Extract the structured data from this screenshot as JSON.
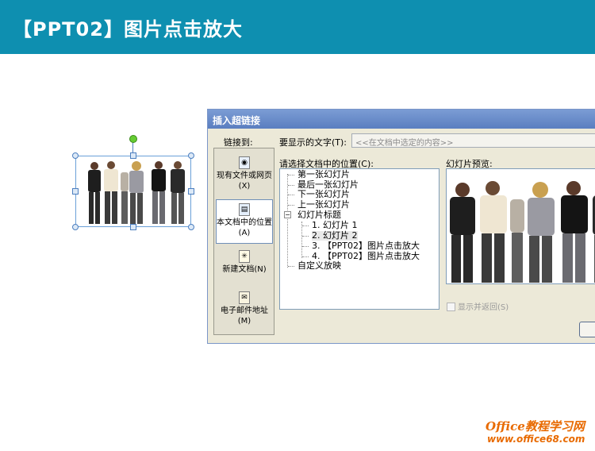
{
  "slide": {
    "title": "【PPT02】图片点击放大"
  },
  "dialog": {
    "title": "插入超链接",
    "link_to_label": "链接到:",
    "link_options": [
      {
        "label": "现有文件或网页(X)",
        "icon": "globe-file-icon"
      },
      {
        "label": "本文档中的位置(A)",
        "icon": "document-place-icon"
      },
      {
        "label": "新建文档(N)",
        "icon": "new-document-icon"
      },
      {
        "label": "电子邮件地址(M)",
        "icon": "email-icon"
      }
    ],
    "display_text_label": "要显示的文字(T):",
    "display_text_value": "<<在文档中选定的内容>>",
    "location_label": "请选择文档中的位置(C):",
    "tree": [
      "第一张幻灯片",
      "最后一张幻灯片",
      "下一张幻灯片",
      "上一张幻灯片",
      "幻灯片标题",
      "1. 幻灯片 1",
      "2. 幻灯片 2",
      "3. 【PPT02】图片点击放大",
      "4. 【PPT02】图片点击放大",
      "自定义放映"
    ],
    "expander": "−",
    "preview_label": "幻灯片预览:",
    "show_return_label": "显示并返回(S)"
  },
  "watermark": {
    "line1": "Office教程学习网",
    "line2": "www.office68.com"
  }
}
